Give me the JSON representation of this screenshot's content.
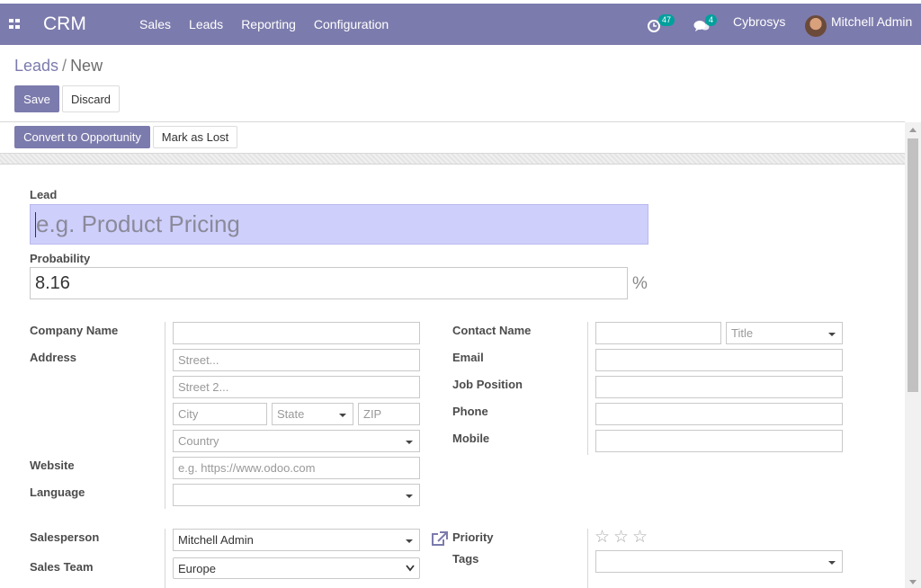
{
  "navbar": {
    "brand": "CRM",
    "menu": [
      "Sales",
      "Leads",
      "Reporting",
      "Configuration"
    ],
    "activity_count": "47",
    "message_count": "4",
    "company": "Cybrosys",
    "user": "Mitchell Admin"
  },
  "breadcrumb": {
    "parent": "Leads",
    "separator": "/",
    "current": "New"
  },
  "buttons": {
    "save": "Save",
    "discard": "Discard",
    "convert": "Convert to Opportunity",
    "lost": "Mark as Lost"
  },
  "form": {
    "lead_label": "Lead",
    "lead_placeholder": "e.g. Product Pricing",
    "probability_label": "Probability",
    "probability_value": "8.16",
    "probability_unit": "%",
    "company_name_label": "Company Name",
    "address_label": "Address",
    "street_ph": "Street...",
    "street2_ph": "Street 2...",
    "city_ph": "City",
    "state_ph": "State",
    "zip_ph": "ZIP",
    "country_ph": "Country",
    "website_label": "Website",
    "website_ph": "e.g. https://www.odoo.com",
    "language_label": "Language",
    "contact_name_label": "Contact Name",
    "title_ph": "Title",
    "email_label": "Email",
    "job_label": "Job Position",
    "phone_label": "Phone",
    "mobile_label": "Mobile",
    "salesperson_label": "Salesperson",
    "salesperson_value": "Mitchell Admin",
    "team_label": "Sales Team",
    "team_value": "Europe",
    "priority_label": "Priority",
    "tags_label": "Tags"
  },
  "colors": {
    "brand": "#7c7bad",
    "badge": "#00a09d",
    "lead_field": "#cfcffc"
  }
}
